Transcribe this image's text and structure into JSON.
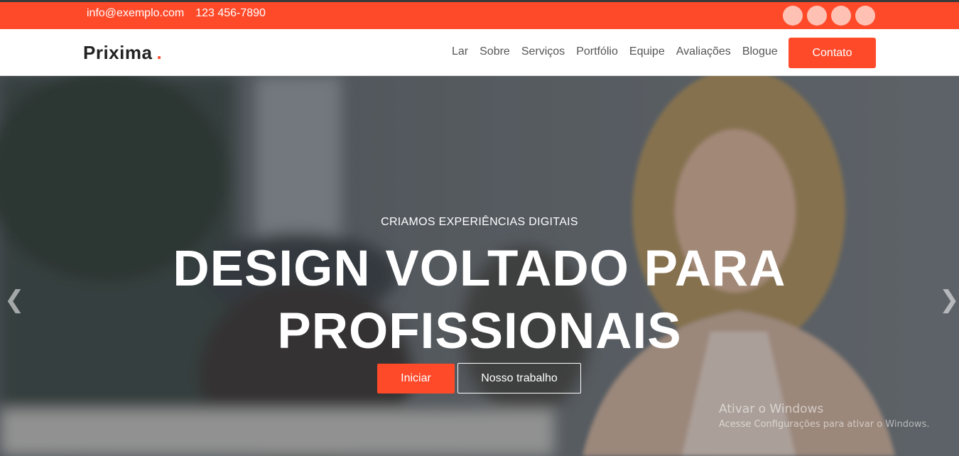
{
  "topbar": {
    "email": "info@exemplo.com",
    "phone": "123 456-7890",
    "socials": [
      "social-icon-1",
      "social-icon-2",
      "social-icon-3",
      "social-icon-4"
    ]
  },
  "navbar": {
    "logo": "Prixima",
    "logo_dot": ".",
    "links": [
      "Lar",
      "Sobre",
      "Serviços",
      "Portfólio",
      "Equipe",
      "Avaliações",
      "Blogue"
    ],
    "cta": "Contato"
  },
  "hero": {
    "eyebrow": "CRIAMOS EXPERIÊNCIAS DIGITAIS",
    "title_line1": "DESIGN VOLTADO PARA",
    "title_line2": "PROFISSIONAIS",
    "primary_button": "Iniciar",
    "secondary_button": "Nosso trabalho",
    "prev_arrow": "❮",
    "next_arrow": "❯"
  },
  "watermark": {
    "line1": "Ativar o Windows",
    "line2": "Acesse Configurações para ativar o Windows."
  },
  "colors": {
    "accent": "#ff4a2a",
    "topbar_border": "#3a3a3a",
    "social_circle": "#ffc1b3"
  }
}
